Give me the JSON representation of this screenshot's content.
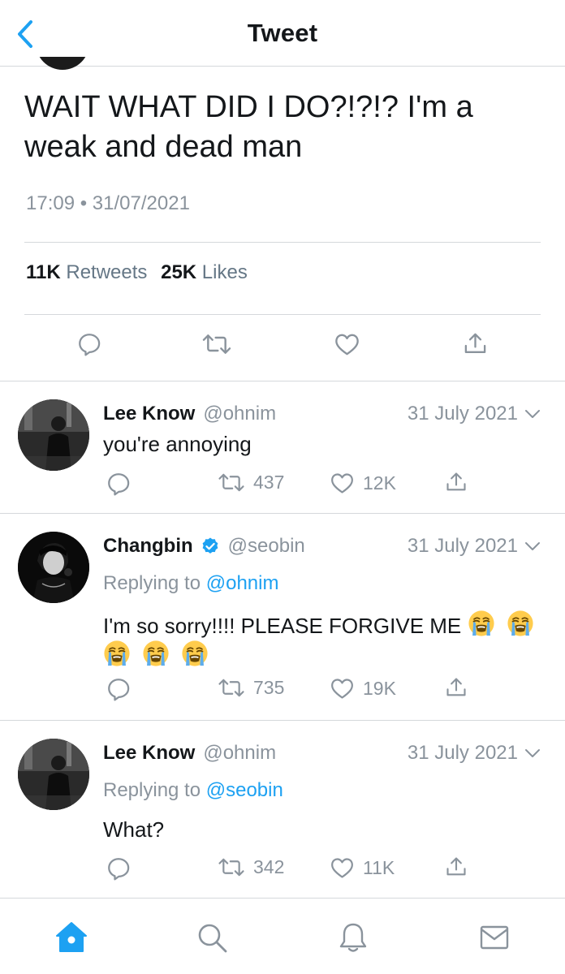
{
  "header": {
    "title": "Tweet"
  },
  "main_tweet": {
    "text": "WAIT WHAT DID I DO?!?!? I'm a weak and dead man",
    "timestamp": "17:09 • 31/07/2021",
    "retweets_count": "11K",
    "retweets_label": "Retweets",
    "likes_count": "25K",
    "likes_label": "Likes"
  },
  "replies": [
    {
      "name": "Lee Know",
      "handle": "@ohnim",
      "date": "31 July 2021",
      "replying_to": "",
      "text": "you're annoying",
      "retweets": "437",
      "likes": "12K"
    },
    {
      "name": "Changbin",
      "handle": "@seobin",
      "verified": true,
      "date": "31 July 2021",
      "replying_label": "Replying to",
      "replying_to": "@ohnim",
      "text": "I'm so sorry!!!! PLEASE FORGIVE ME",
      "emoji": "loudly-crying-face",
      "retweets": "735",
      "likes": "19K"
    },
    {
      "name": "Lee Know",
      "handle": "@ohnim",
      "date": "31 July 2021",
      "replying_label": "Replying to",
      "replying_to": "@seobin",
      "text": "What?",
      "retweets": "342",
      "likes": "11K"
    }
  ],
  "tabs": [
    {
      "icon": "home-icon",
      "active": true
    },
    {
      "icon": "search-icon"
    },
    {
      "icon": "bell-icon"
    },
    {
      "icon": "mail-icon"
    }
  ],
  "colors": {
    "accent": "#1da1f2",
    "muted": "#8a939c",
    "text": "#14171a",
    "divider": "#d5d8db"
  }
}
